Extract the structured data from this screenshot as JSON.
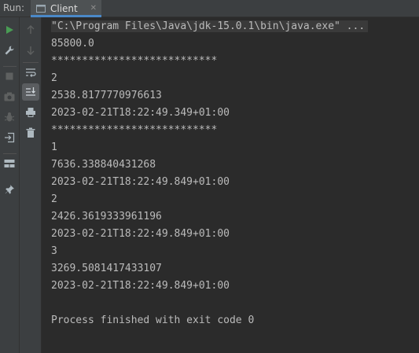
{
  "runbar": {
    "run_label": "Run:",
    "tab_label": "Client",
    "tab_icon": "console-icon",
    "close_icon": "close-icon"
  },
  "toolbar_left": {
    "icons": [
      "run-icon",
      "wrench-icon",
      "stop-icon",
      "camera-icon",
      "debug-icon",
      "login-icon",
      "layout-icon",
      "pin-icon"
    ]
  },
  "toolbar_right": {
    "icons": [
      "arrow-up-icon",
      "arrow-down-icon",
      "soft-wrap-icon",
      "scroll-to-end-icon",
      "print-icon",
      "trash-icon"
    ]
  },
  "console": {
    "lines": [
      "\"C:\\Program Files\\Java\\jdk-15.0.1\\bin\\java.exe\" ...",
      "85800.0",
      "***************************",
      "2",
      "2538.8177770976613",
      "2023-02-21T18:22:49.349+01:00",
      "***************************",
      "1",
      "7636.338840431268",
      "2023-02-21T18:22:49.849+01:00",
      "2",
      "2426.3619333961196",
      "2023-02-21T18:22:49.849+01:00",
      "3",
      "3269.5081417433107",
      "2023-02-21T18:22:49.849+01:00",
      "",
      "Process finished with exit code 0"
    ]
  },
  "colors": {
    "background": "#2b2b2b",
    "panel": "#3c3f41",
    "text": "#bbbbbb",
    "run_green": "#499c54",
    "accent": "#4a88c7"
  }
}
